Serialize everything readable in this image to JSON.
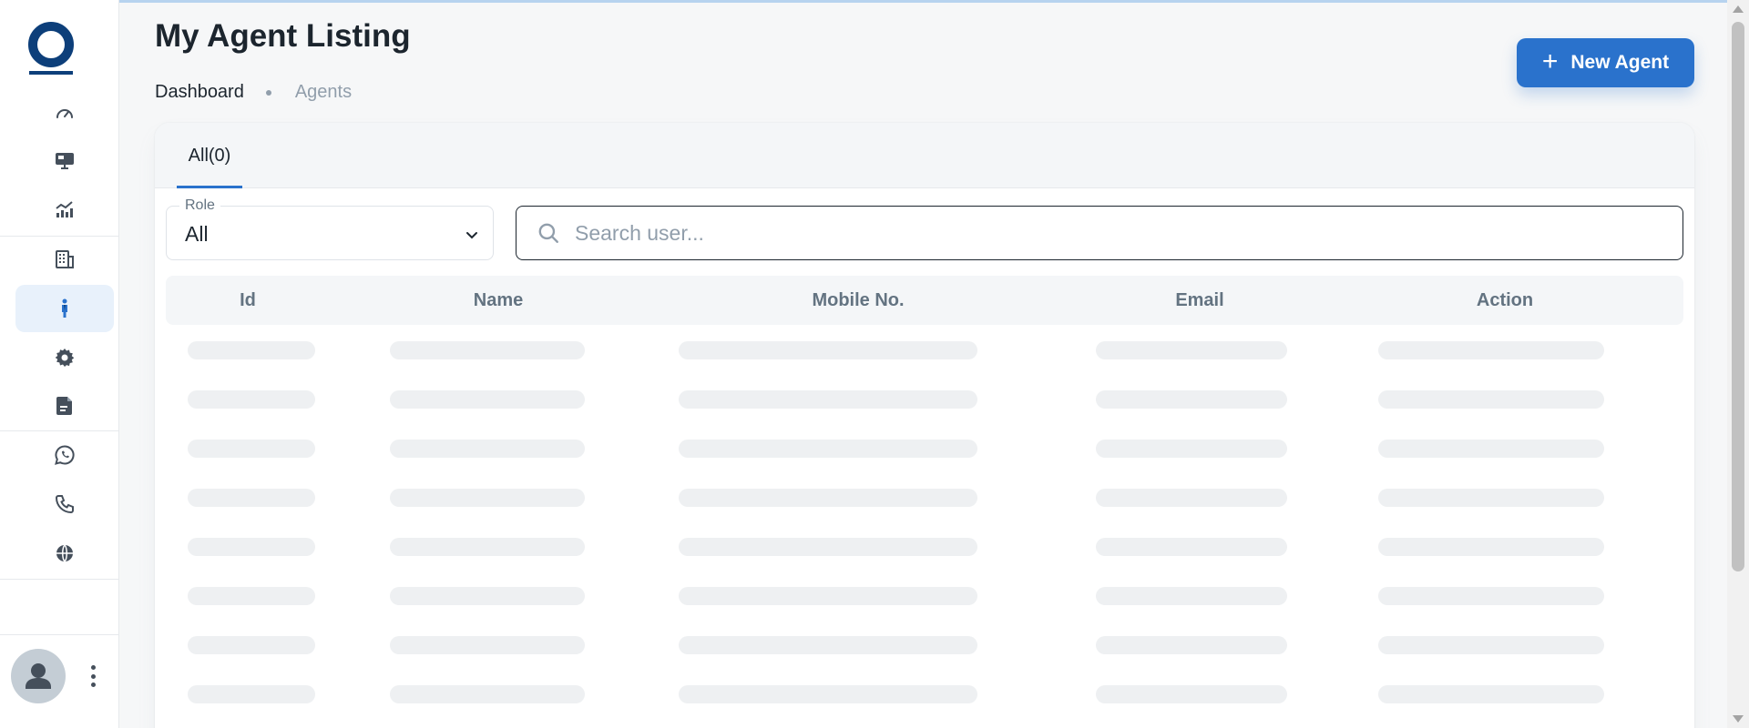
{
  "sidebar": {
    "logo": "brand-logo",
    "items": [
      {
        "name": "dashboard",
        "icon": "speedometer-icon"
      },
      {
        "name": "presentation",
        "icon": "presentation-board-icon"
      },
      {
        "name": "analytics",
        "icon": "bar-chart-trend-icon"
      },
      {
        "name": "buildings",
        "icon": "building-icon"
      },
      {
        "name": "agents",
        "icon": "person-icon",
        "active": true
      },
      {
        "name": "settings",
        "icon": "gear-icon"
      },
      {
        "name": "documents",
        "icon": "document-icon"
      },
      {
        "name": "whatsapp",
        "icon": "whatsapp-icon"
      },
      {
        "name": "calls",
        "icon": "phone-icon"
      },
      {
        "name": "web",
        "icon": "globe-icon"
      }
    ],
    "user": {
      "icon": "avatar-icon",
      "menu_icon": "kebab-menu-icon"
    }
  },
  "header": {
    "title": "My Agent Listing",
    "breadcrumb": [
      "Dashboard",
      "Agents"
    ],
    "new_button_label": "New Agent"
  },
  "tabs": [
    {
      "label": "All(0)",
      "active": true
    }
  ],
  "filters": {
    "role_label": "Role",
    "role_value": "All",
    "search_placeholder": "Search user..."
  },
  "table": {
    "columns": [
      "Id",
      "Name",
      "Mobile No.",
      "Email",
      "Action"
    ],
    "rows": [],
    "loading_skeleton_rows": 8
  },
  "colors": {
    "accent": "#2a72cc",
    "active_nav_bg": "#e8f1fb",
    "brand": "#0d3f7a",
    "skeleton": "#eef0f2"
  }
}
